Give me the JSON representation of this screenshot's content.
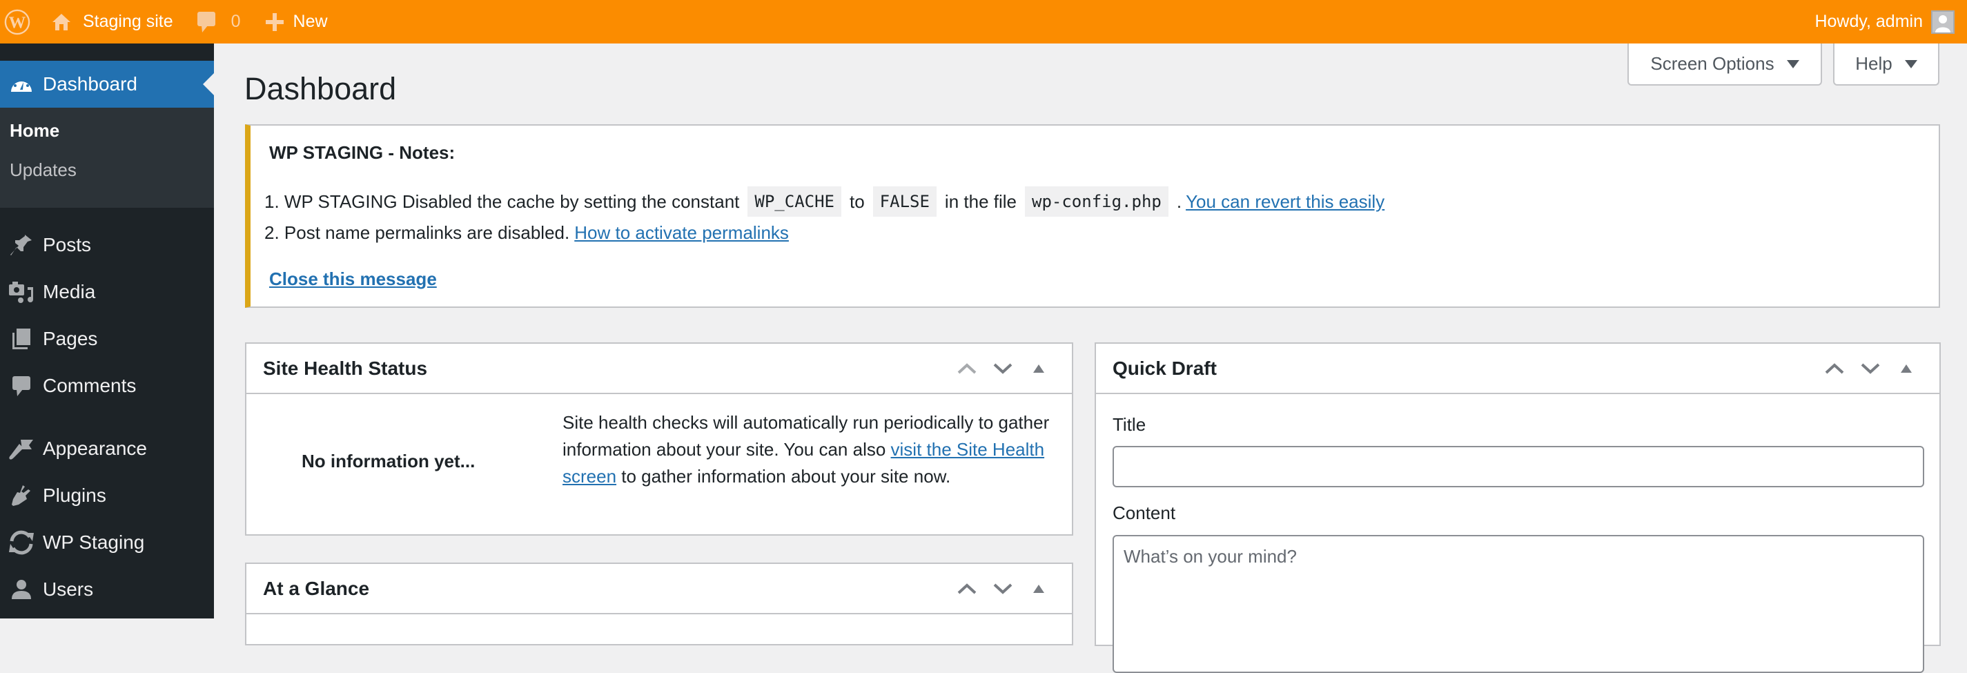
{
  "adminbar": {
    "site_name": "Staging site",
    "comments_count": "0",
    "new_label": "New",
    "howdy": "Howdy, admin"
  },
  "sidebar": {
    "items": [
      {
        "label": "Dashboard",
        "icon": "dashboard-icon",
        "current": true
      },
      {
        "label": "Posts",
        "icon": "pushpin-icon"
      },
      {
        "label": "Media",
        "icon": "media-icon"
      },
      {
        "label": "Pages",
        "icon": "pages-icon"
      },
      {
        "label": "Comments",
        "icon": "comment-icon"
      },
      {
        "label": "Appearance",
        "icon": "paintbrush-icon"
      },
      {
        "label": "Plugins",
        "icon": "plugin-icon"
      },
      {
        "label": "WP Staging",
        "icon": "sync-icon"
      },
      {
        "label": "Users",
        "icon": "user-icon"
      }
    ],
    "submenu": [
      {
        "label": "Home",
        "active": true
      },
      {
        "label": "Updates",
        "active": false
      }
    ]
  },
  "header": {
    "page_title": "Dashboard",
    "screen_options_label": "Screen Options",
    "help_label": "Help"
  },
  "notice": {
    "title": "WP STAGING - Notes:",
    "line1": {
      "prefix": "1. WP STAGING Disabled the cache by setting the constant",
      "code1": "WP_CACHE",
      "mid1": "to",
      "code2": "FALSE",
      "mid2": "in the file",
      "code3": "wp-config.php",
      "suffix": ".",
      "link": "You can revert this easily"
    },
    "line2": {
      "prefix": "2. Post name permalinks are disabled.",
      "link": "How to activate permalinks"
    },
    "close_label": "Close this message"
  },
  "site_health": {
    "title": "Site Health Status",
    "no_info": "No information yet...",
    "desc_before": "Site health checks will automatically run periodically to gather information about your site. You can also ",
    "desc_link": "visit the Site Health screen",
    "desc_after": " to gather information about your site now."
  },
  "at_a_glance": {
    "title": "At a Glance"
  },
  "quick_draft": {
    "title": "Quick Draft",
    "title_label": "Title",
    "title_value": "",
    "content_label": "Content",
    "content_placeholder": "What’s on your mind?"
  },
  "colors": {
    "adminbar_bg": "#fb8c00",
    "sidebar_bg": "#1d2327",
    "submenu_bg": "#2c3338",
    "accent": "#2271b1",
    "notice_border": "#dba617"
  }
}
